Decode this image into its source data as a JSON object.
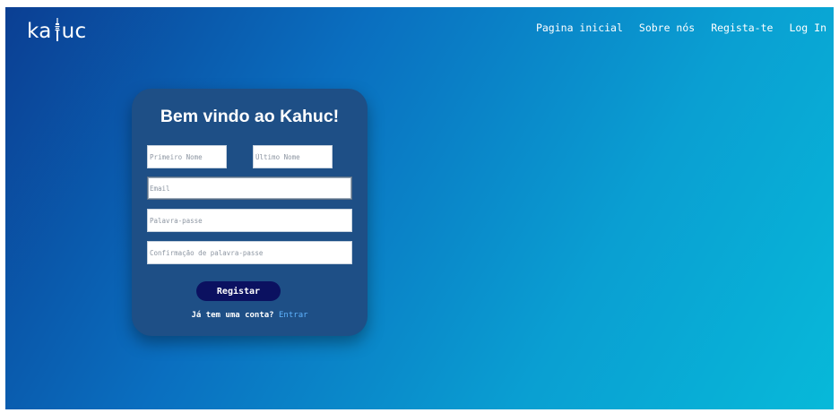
{
  "brand": {
    "logo_left": "ka",
    "logo_right": "uc",
    "logo_icon": "tower-icon"
  },
  "nav": {
    "items": [
      {
        "label": "Pagina inicial"
      },
      {
        "label": "Sobre nós"
      },
      {
        "label": "Regista-te"
      },
      {
        "label": "Log In"
      }
    ]
  },
  "form": {
    "title": "Bem vindo ao Kahuc!",
    "first_name_placeholder": "Primeiro Nome",
    "last_name_placeholder": "Último Nome",
    "email_placeholder": "Email",
    "password_placeholder": "Palavra-passe",
    "confirm_placeholder": "Confirmação de palavra-passe",
    "register_label": "Registar",
    "have_account_text": "Já tem uma conta?",
    "signin_link": "Entrar"
  },
  "colors": {
    "gradient_start": "#0b3f93",
    "gradient_end": "#07b9d9",
    "card": "#1e4f86",
    "button": "#0b1160",
    "link": "#5fb3ff"
  }
}
